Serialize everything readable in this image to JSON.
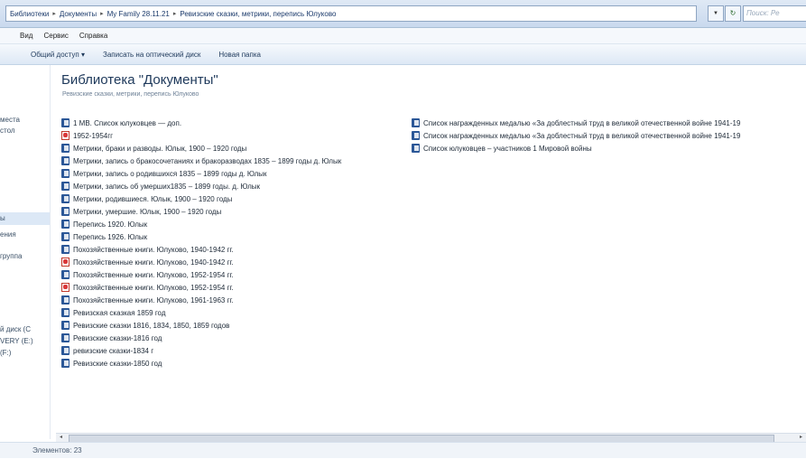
{
  "address": {
    "crumbs": [
      "Библиотеки",
      "Документы",
      "My Family 28.11.21",
      "Ревизские сказки, метрики, перепись Юлуково"
    ],
    "search_placeholder": "Поиск: Ре"
  },
  "menu": [
    "Вид",
    "Сервис",
    "Справка"
  ],
  "toolbar": [
    "Общий доступ ▾",
    "Записать на оптический диск",
    "Новая папка"
  ],
  "nav_items": [
    "места",
    "стол",
    "",
    "ы",
    "ения",
    "группа",
    "й диск (C",
    "VERY (E:)",
    "(F:)"
  ],
  "library": {
    "title": "Библиотека \"Документы\"",
    "subtitle": "Ревизские сказки, метрики, перепись Юлуково"
  },
  "files_col1": [
    {
      "name": "1 МВ. Список юлуковцев — доп.",
      "icon": "doc-icon"
    },
    {
      "name": "1952-1954гг",
      "icon": "pdf-icon"
    },
    {
      "name": "Метрики, браки и разводы. Юлык, 1900 – 1920 годы",
      "icon": "doc-icon"
    },
    {
      "name": "Метрики, запись о бракосочетаниях и бракоразводах 1835 – 1899 годы д. Юлык",
      "icon": "doc-icon"
    },
    {
      "name": "Метрики, запись о родившихся 1835 – 1899 годы д. Юлык",
      "icon": "doc-icon"
    },
    {
      "name": "Метрики, запись об умерших1835 – 1899 годы. д. Юлык",
      "icon": "doc-icon"
    },
    {
      "name": "Метрики, родившиеся. Юлык, 1900 – 1920 годы",
      "icon": "doc-icon"
    },
    {
      "name": "Метрики, умершие. Юлык, 1900 – 1920 годы",
      "icon": "doc-icon"
    },
    {
      "name": "Перепись 1920. Юлык",
      "icon": "doc-icon"
    },
    {
      "name": "Перепись 1926. Юлык",
      "icon": "doc-icon"
    },
    {
      "name": "Похозяйственные книги. Юлуково, 1940-1942 гг.",
      "icon": "doc-icon"
    },
    {
      "name": "Похозяйственные книги. Юлуково, 1940-1942 гг.",
      "icon": "pdf-icon"
    },
    {
      "name": "Похозяйственные книги. Юлуково, 1952-1954 гг.",
      "icon": "doc-icon"
    },
    {
      "name": "Похозяйственные книги. Юлуково, 1952-1954 гг.",
      "icon": "pdf-icon"
    },
    {
      "name": "Похозяйственные книги. Юлуково, 1961-1963 гг.",
      "icon": "doc-icon"
    },
    {
      "name": "Ревизская сказкая 1859 год",
      "icon": "doc-icon"
    },
    {
      "name": "Ревизские сказки 1816, 1834, 1850, 1859 годов",
      "icon": "doc-icon"
    },
    {
      "name": "Ревизские сказки-1816 год",
      "icon": "doc-icon"
    },
    {
      "name": "ревизские сказки-1834 г",
      "icon": "doc-icon"
    },
    {
      "name": "Ревизские сказки-1850 год",
      "icon": "doc-icon"
    }
  ],
  "files_col2": [
    {
      "name": "Список награжденных медалью «За доблестный труд в великой отечественной войне 1941-19",
      "icon": "doc-icon"
    },
    {
      "name": "Список награжденных медалью «За доблестный труд в великой отечественной войне 1941-19",
      "icon": "doc-icon"
    },
    {
      "name": "Список юлуковцев – участников 1 Мировой войны",
      "icon": "doc-icon"
    }
  ],
  "status": "Элементов: 23"
}
